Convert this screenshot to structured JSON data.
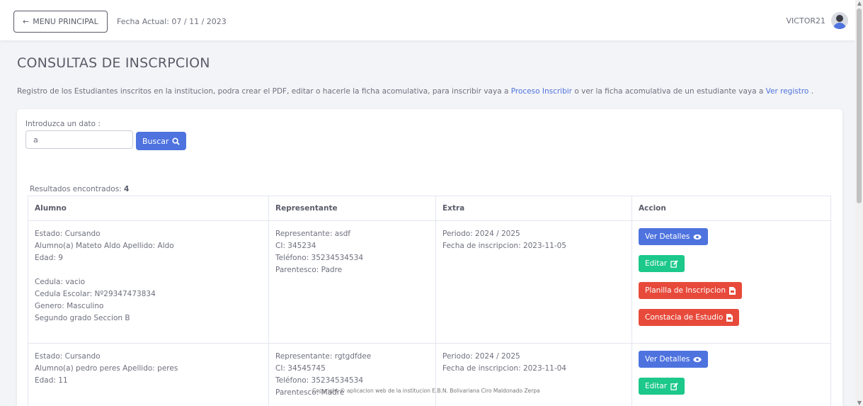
{
  "topbar": {
    "menu_label": "MENU PRINCIPAL",
    "date_text": "Fecha Actual: 07 / 11 / 2023",
    "username": "VICTOR21"
  },
  "page": {
    "title": "CONSULTAS DE INSCRPCION",
    "intro_before": "Registro de los Estudiantes inscritos en la institucion, podra crear el PDF, editar o hacerle la ficha acomulativa, para inscribir vaya a ",
    "intro_link1": "Proceso Inscribir",
    "intro_middle": " o ver la ficha acomulativa de un estudiante vaya a ",
    "intro_link2": "Ver registro",
    "intro_after": " ."
  },
  "search": {
    "label": "Introduzca un dato :",
    "value": "a",
    "button": "Buscar"
  },
  "results": {
    "label": "Resultados encontrados: ",
    "count": "4"
  },
  "table": {
    "headers": [
      "Alumno",
      "Representante",
      "Extra",
      "Accion"
    ],
    "rows": [
      {
        "estado": "Estado: Cursando",
        "alumno": "Alumno(a) Mateto Aldo Apellido: Aldo",
        "edad": "Edad: 9",
        "cedula": "Cedula: vacio",
        "cedula_escolar": "Cedula Escolar: Nº29347473834",
        "genero": "Genero: Masculino",
        "grado": "Segundo grado Seccion B",
        "representante": "Representante: asdf",
        "ci": "CI: 345234",
        "telefono": "Teléfono: 35234534534",
        "parentesco": "Parentesco: Padre",
        "periodo": "Periodo: 2024 / 2025",
        "fecha": "Fecha de inscripcion: 2023-11-05"
      },
      {
        "estado": "Estado: Cursando",
        "alumno": "Alumno(a) pedro peres Apellido: peres",
        "edad": "Edad: 11",
        "representante": "Representante: rgtgdfdee",
        "ci": "CI: 34545745",
        "telefono": "Teléfono: 35234534534",
        "parentesco": "Parentesco: Madre",
        "periodo": "Periodo: 2024 / 2025",
        "fecha": "Fecha de inscripcion: 2023-11-04"
      }
    ],
    "actions": {
      "ver": "Ver Detalles",
      "editar": "Editar",
      "planilla": "Planilla de Inscripcion",
      "constancia": "Constacia de Estudio"
    }
  },
  "footer": {
    "text": "Copyright © aplicacion web de la institucion E.B.N. Bolivariana Ciro Maldonado Zerpa"
  },
  "colors": {
    "primary": "#4e73df",
    "success": "#1cc88a",
    "danger": "#e74a3b"
  }
}
